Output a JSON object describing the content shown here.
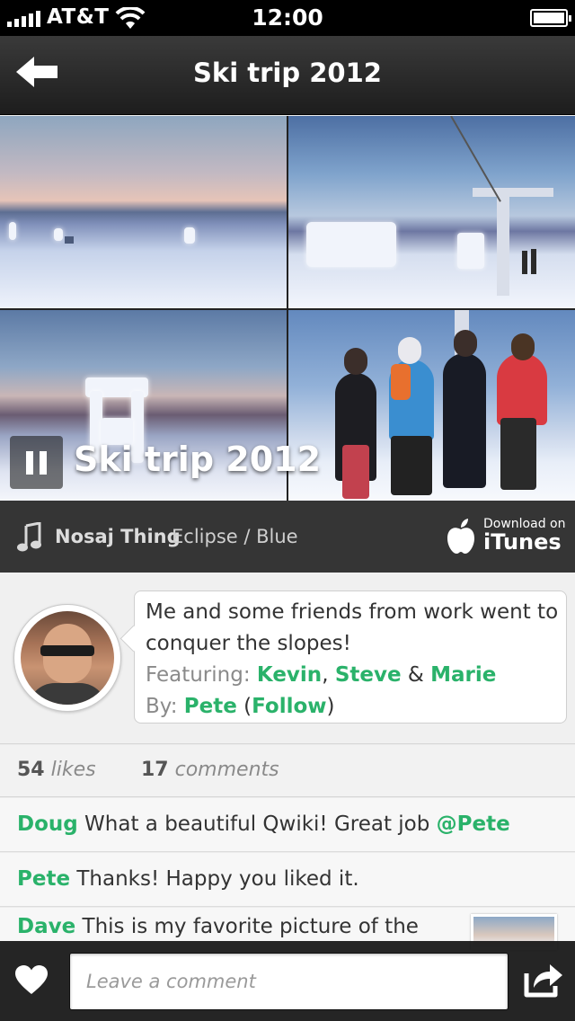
{
  "status_bar": {
    "carrier": "AT&T",
    "time": "12:00"
  },
  "nav": {
    "title": "Ski trip 2012",
    "back_icon": "back-arrow-icon"
  },
  "slideshow": {
    "overlay_title": "Ski trip 2012",
    "playback_icon": "pause-icon"
  },
  "music": {
    "artist": "Nosaj Thing",
    "track": "Eclipse / Blue",
    "store_small": "Download on",
    "store_label": "iTunes"
  },
  "description": {
    "text": "Me and some friends from work went to conquer the slopes!",
    "featuring_label": "Featuring:",
    "friend_1": "Kevin",
    "sep_1": ",",
    "friend_2": "Steve",
    "amp": "&",
    "friend_3": "Marie",
    "by_label": "By:",
    "author": "Pete",
    "follow": "Follow"
  },
  "stats": {
    "likes_count": "54",
    "likes_label": "likes",
    "comments_count": "17",
    "comments_label": "comments"
  },
  "comments": [
    {
      "author": "Doug",
      "text": "What a beautiful Qwiki! Great job",
      "mention": "@Pete"
    },
    {
      "author": "Pete",
      "text": "Thanks! Happy you liked it."
    },
    {
      "author": "Dave",
      "text": "This is my favorite picture of the"
    }
  ],
  "comment_box": {
    "placeholder": "Leave a comment"
  },
  "colors": {
    "accent_green": "#2ab26a",
    "nav_dark": "#1d1d1d",
    "music_bar": "#353535"
  }
}
